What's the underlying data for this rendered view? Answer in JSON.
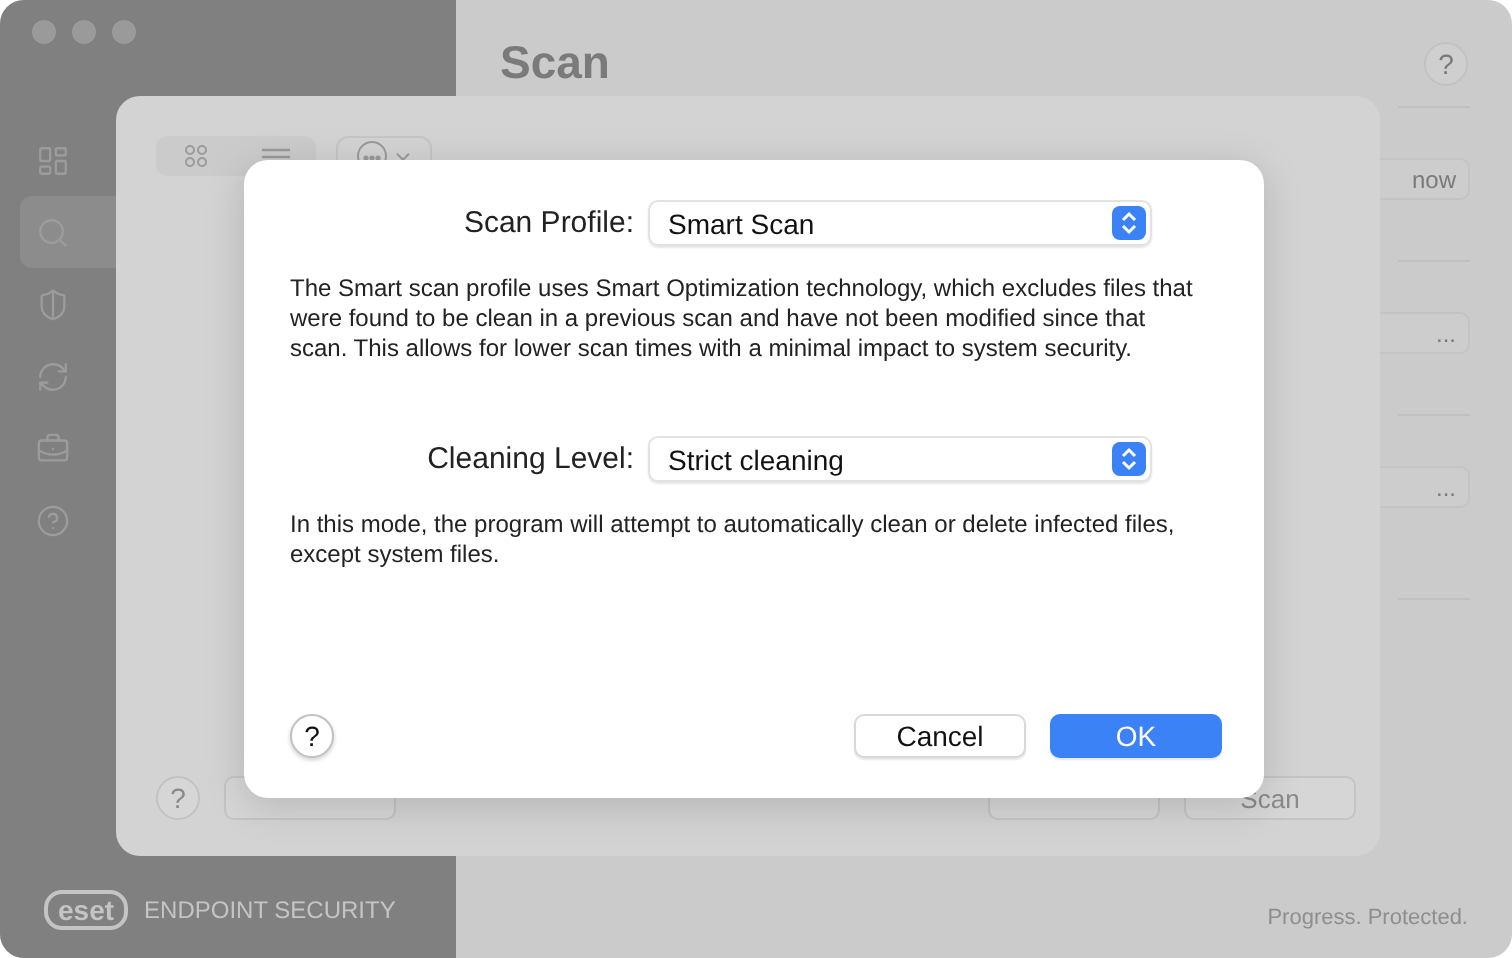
{
  "sidebar": {
    "items": [
      {
        "kind": "overview",
        "selected": false
      },
      {
        "kind": "search",
        "selected": true
      },
      {
        "kind": "shield",
        "selected": false
      },
      {
        "kind": "update",
        "selected": false
      },
      {
        "kind": "tools",
        "selected": false
      },
      {
        "kind": "help",
        "selected": false
      }
    ],
    "logo": "eset",
    "product": "ENDPOINT SECURITY"
  },
  "main": {
    "title": "Scan",
    "help": "?",
    "buttons": [
      "now",
      "...",
      "..."
    ],
    "tagline": "Progress. Protected."
  },
  "sheet": {
    "help": "?",
    "buttons": [
      {
        "kind": "covered"
      },
      {
        "kind": "covered"
      },
      {
        "kind": "text",
        "label": "Scan"
      }
    ]
  },
  "dialog": {
    "fields": [
      {
        "label": "Scan Profile:",
        "value": "Smart Scan",
        "description": "The Smart scan profile uses Smart Optimization technology, which excludes files that were found to be clean in a previous scan and have not been modified since that scan. This allows for lower scan times with a minimal impact to system security."
      },
      {
        "label": "Cleaning Level:",
        "value": "Strict cleaning",
        "description": "In this mode, the program will attempt to automatically clean or delete infected files, except system files."
      }
    ],
    "help": "?",
    "cancel": "Cancel",
    "ok": "OK"
  }
}
